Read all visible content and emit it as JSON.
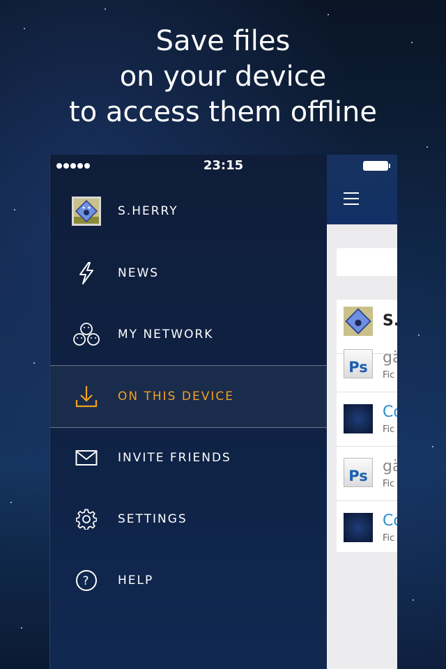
{
  "headline": {
    "line1": "Save files",
    "line2": "on your device",
    "line3": "to access them offline"
  },
  "status_bar": {
    "time": "23:15"
  },
  "menu": {
    "items": [
      {
        "label": "S.HERRY",
        "icon": "avatar"
      },
      {
        "label": "NEWS",
        "icon": "bolt-icon"
      },
      {
        "label": "MY NETWORK",
        "icon": "network-icon"
      },
      {
        "label": "ON THIS DEVICE",
        "icon": "download-icon",
        "active": true
      },
      {
        "label": "INVITE FRIENDS",
        "icon": "envelope-icon"
      },
      {
        "label": "SETTINGS",
        "icon": "gear-icon"
      },
      {
        "label": "HELP",
        "icon": "help-icon"
      }
    ],
    "active_color": "#f2a020"
  },
  "content": {
    "rows": [
      {
        "title": "S.",
        "subtitle": "",
        "thumb": "avatar"
      },
      {
        "title": "gä",
        "subtitle": "Fic",
        "thumb": "Ps"
      },
      {
        "title": "Co",
        "subtitle": "Fic",
        "thumb": "space"
      },
      {
        "title": "gä",
        "subtitle": "Fic",
        "thumb": "Ps"
      },
      {
        "title": "Co",
        "subtitle": "Fic",
        "thumb": "space"
      }
    ]
  }
}
